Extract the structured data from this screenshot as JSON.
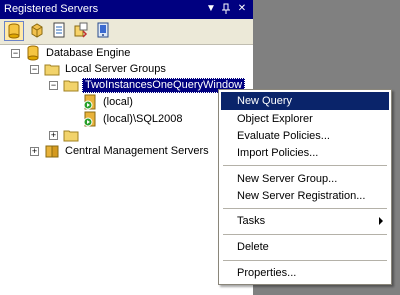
{
  "window": {
    "title": "Registered Servers"
  },
  "toolbar": {
    "icons": [
      "database-engine-icon",
      "analysis-services-icon",
      "reporting-services-icon",
      "integration-services-icon",
      "compact-edition-icon"
    ]
  },
  "tree": {
    "root": "Database Engine",
    "local_groups": "Local Server Groups",
    "selected_group": "TwoInstancesOneQueryWindow",
    "server1": "(local)",
    "server2": "(local)\\SQL2008",
    "cms": "Central Management Servers"
  },
  "context_menu": {
    "new_query": "New Query",
    "object_explorer": "Object Explorer",
    "evaluate": "Evaluate Policies...",
    "import": "Import Policies...",
    "new_group": "New Server Group...",
    "new_registration": "New Server Registration...",
    "tasks": "Tasks",
    "delete": "Delete",
    "properties": "Properties..."
  },
  "colors": {
    "selection": "#000080",
    "menu_highlight": "#0a246a",
    "folder": "#f2d36b",
    "server": "#e8b23a"
  }
}
